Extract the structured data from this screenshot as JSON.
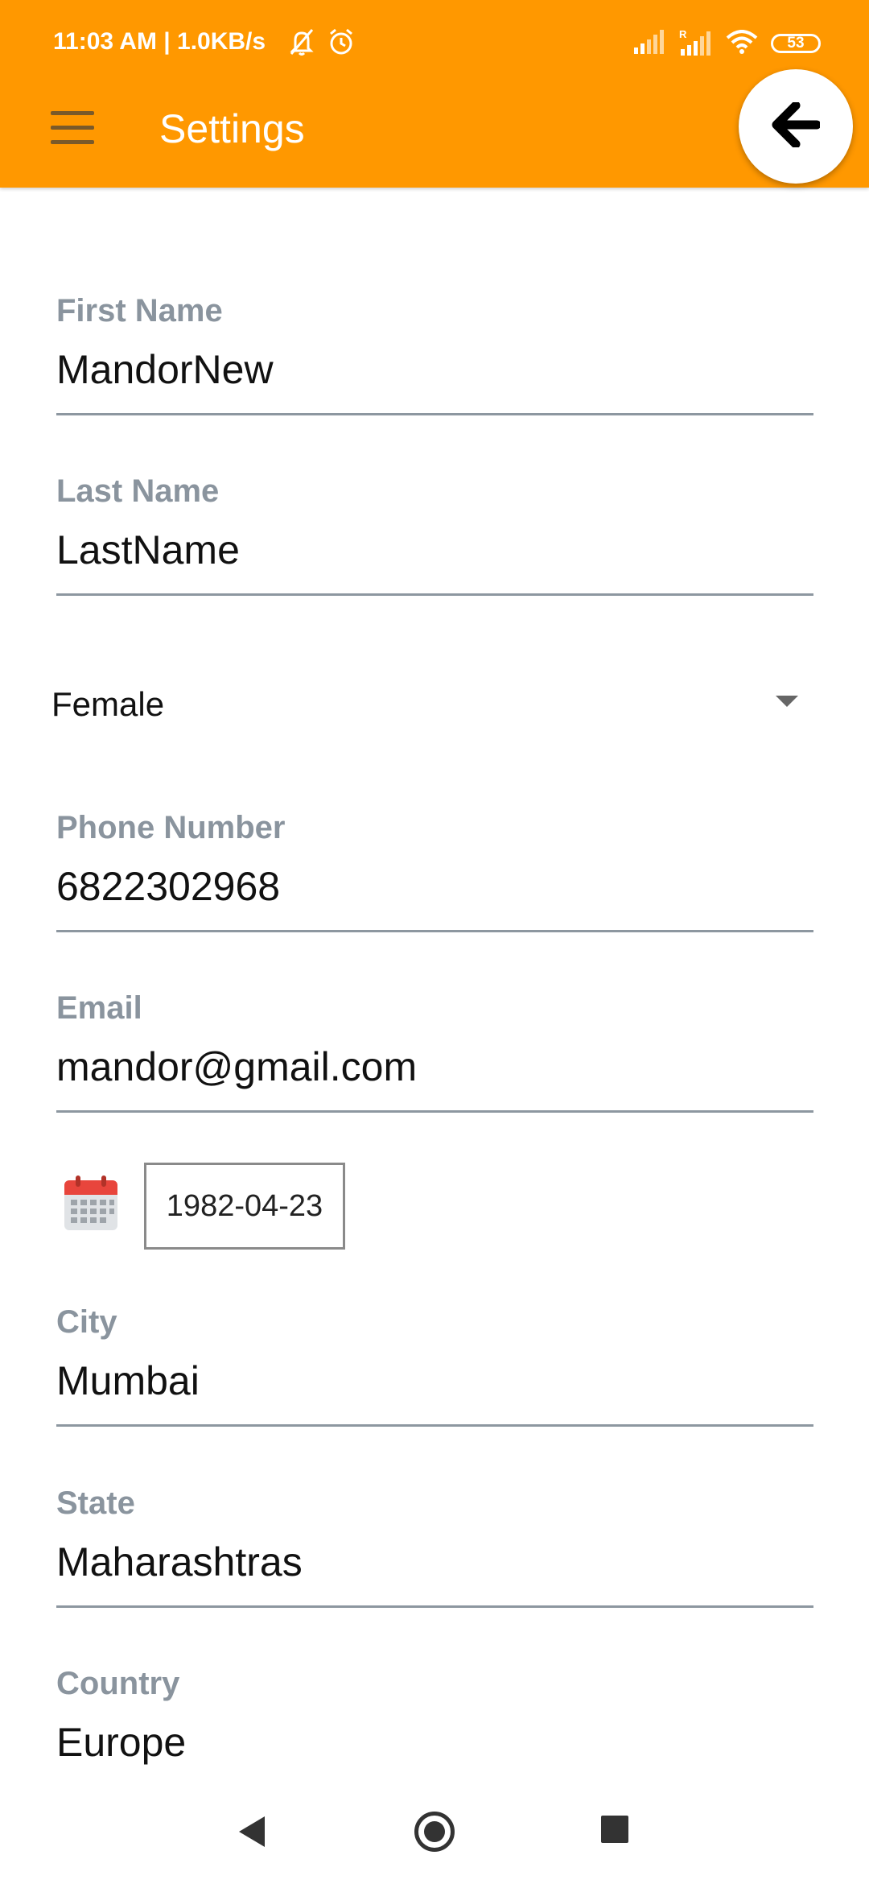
{
  "status_bar": {
    "time_text": "11:03 AM | 1.0KB/s",
    "battery": "53"
  },
  "header": {
    "title": "Settings"
  },
  "form": {
    "first_name": {
      "label": "First Name",
      "value": "MandorNew"
    },
    "last_name": {
      "label": "Last Name",
      "value": "LastName"
    },
    "gender": {
      "value": "Female"
    },
    "phone": {
      "label": "Phone Number",
      "value": "6822302968"
    },
    "email": {
      "label": "Email",
      "value": "mandor@gmail.com"
    },
    "dob": {
      "value": "1982-04-23"
    },
    "city": {
      "label": "City",
      "value": "Mumbai"
    },
    "state": {
      "label": "State",
      "value": "Maharashtras"
    },
    "country": {
      "label": "Country",
      "value": "Europe"
    }
  },
  "icons": {
    "menu": "hamburger-menu-icon",
    "back": "arrow-left-icon",
    "calendar": "calendar-icon",
    "nav_back": "triangle-back-icon",
    "nav_home": "circle-home-icon",
    "nav_recent": "square-recents-icon"
  },
  "colors": {
    "appbar": "#FF9800",
    "label": "#8a949e",
    "underline": "#8d97a0",
    "calendar_red": "#e8453c"
  }
}
